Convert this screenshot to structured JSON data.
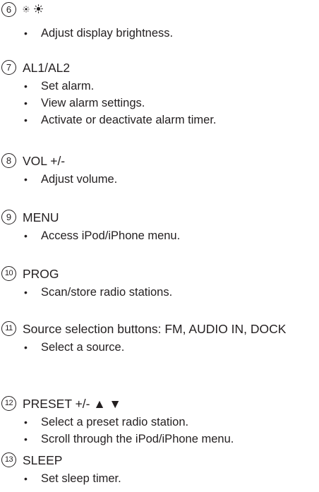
{
  "items": [
    {
      "number": "6",
      "title": "",
      "icon": "brightness-icon",
      "bullets": [
        "Adjust display brightness."
      ]
    },
    {
      "number": "7",
      "title": "AL1/AL2",
      "bullets": [
        "Set alarm.",
        "View alarm settings.",
        "Activate or deactivate alarm timer."
      ]
    },
    {
      "number": "8",
      "title": "VOL +/-",
      "bullets": [
        "Adjust volume."
      ]
    },
    {
      "number": "9",
      "title": "MENU",
      "bullets": [
        "Access iPod/iPhone menu."
      ]
    },
    {
      "number": "10",
      "title": "PROG",
      "bullets": [
        "Scan/store radio stations."
      ]
    },
    {
      "number": "11",
      "title": "Source selection buttons: FM, AUDIO IN, DOCK",
      "bullets": [
        "Select a source."
      ]
    },
    {
      "number": "12",
      "title": "PRESET +/- ▲ ▼",
      "bullets": [
        "Select a preset radio station.",
        "Scroll through the iPod/iPhone menu."
      ]
    },
    {
      "number": "13",
      "title": "SLEEP",
      "bullets": [
        "Set sleep timer."
      ]
    }
  ],
  "bullet_char": "•"
}
